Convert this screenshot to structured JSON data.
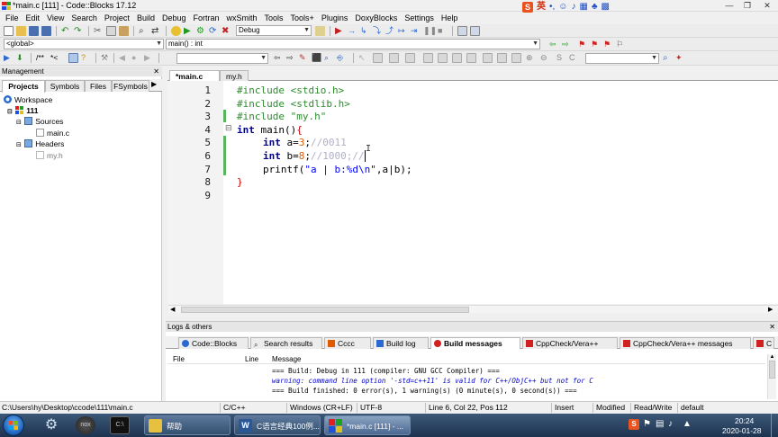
{
  "window": {
    "title": "*main.c [111] - Code::Blocks 17.12"
  },
  "ime": {
    "label": "英"
  },
  "menu": [
    "File",
    "Edit",
    "View",
    "Search",
    "Project",
    "Build",
    "Debug",
    "Fortran",
    "wxSmith",
    "Tools",
    "Tools+",
    "Plugins",
    "DoxyBlocks",
    "Settings",
    "Help"
  ],
  "toolbar": {
    "build_target": "Debug",
    "scope_combo": "<global>",
    "function_combo": "main() : int",
    "doxy_comment": "/**",
    "doxy_line": "*<"
  },
  "management": {
    "title": "Management",
    "tabs": [
      "Projects",
      "Symbols",
      "Files",
      "FSymbols"
    ],
    "tree": {
      "workspace": "Workspace",
      "project": "111",
      "sources": "Sources",
      "source_file": "main.c",
      "headers": "Headers",
      "header_file": "my.h"
    }
  },
  "editor": {
    "tabs": [
      "*main.c",
      "my.h"
    ],
    "line_numbers": [
      "1",
      "2",
      "3",
      "4",
      "5",
      "6",
      "7",
      "8",
      "9"
    ],
    "lines": {
      "l1_pre": "#include <stdio.h>",
      "l2_pre": "#include <stdlib.h>",
      "l3_pre": "#include \"my.h\"",
      "l4_kw": "int",
      "l4_rest": " main()",
      "l4_brace": "{",
      "l5_kw": "int",
      "l5_var": " a=",
      "l5_num": "3",
      "l5_semi": ";",
      "l5_cm": "//0011",
      "l6_kw": "int",
      "l6_var": " b=",
      "l6_num": "8",
      "l6_semi": ";",
      "l6_cm": "//1000;//",
      "l7_fn": "printf(",
      "l7_str": "\"a | b:%d\\n\"",
      "l7_rest": ",a|b);",
      "l8_brace": "}"
    }
  },
  "logs": {
    "title": "Logs & others",
    "tabs": [
      "Code::Blocks",
      "Search results",
      "Cccc",
      "Build log",
      "Build messages",
      "CppCheck/Vera++",
      "CppCheck/Vera++ messages",
      "C"
    ],
    "columns": {
      "file": "File",
      "line": "Line",
      "message": "Message"
    },
    "messages": [
      "=== Build: Debug in 111 (compiler: GNU GCC Compiler) ===",
      "warning: command line option '-std=c++11' is valid for C++/ObjC++ but not for C",
      "=== Build finished: 0 error(s), 1 warning(s) (0 minute(s), 0 second(s)) ==="
    ]
  },
  "statusbar": {
    "path": "C:\\Users\\hy\\Desktop\\ccode\\111\\main.c",
    "language": "C/C++",
    "line_endings": "Windows (CR+LF)",
    "encoding": "UTF-8",
    "position": "Line 6, Col 22, Pos 112",
    "insert_mode": "Insert",
    "modified": "Modified",
    "access": "Read/Write",
    "profile": "default"
  },
  "taskbar": {
    "buttons": [
      "帮助",
      "C语言经典100例...",
      "*main.c [111] - ..."
    ],
    "time": "20:24",
    "date": "2020-01-28"
  },
  "colors": {
    "preprocessor": "#2e8b2e",
    "keyword": "#00008b",
    "number": "#e05a00",
    "comment": "#b0b0c8",
    "string": "#0000ff",
    "change_bar": "#57b65b",
    "warning_text": "#0000cc"
  }
}
